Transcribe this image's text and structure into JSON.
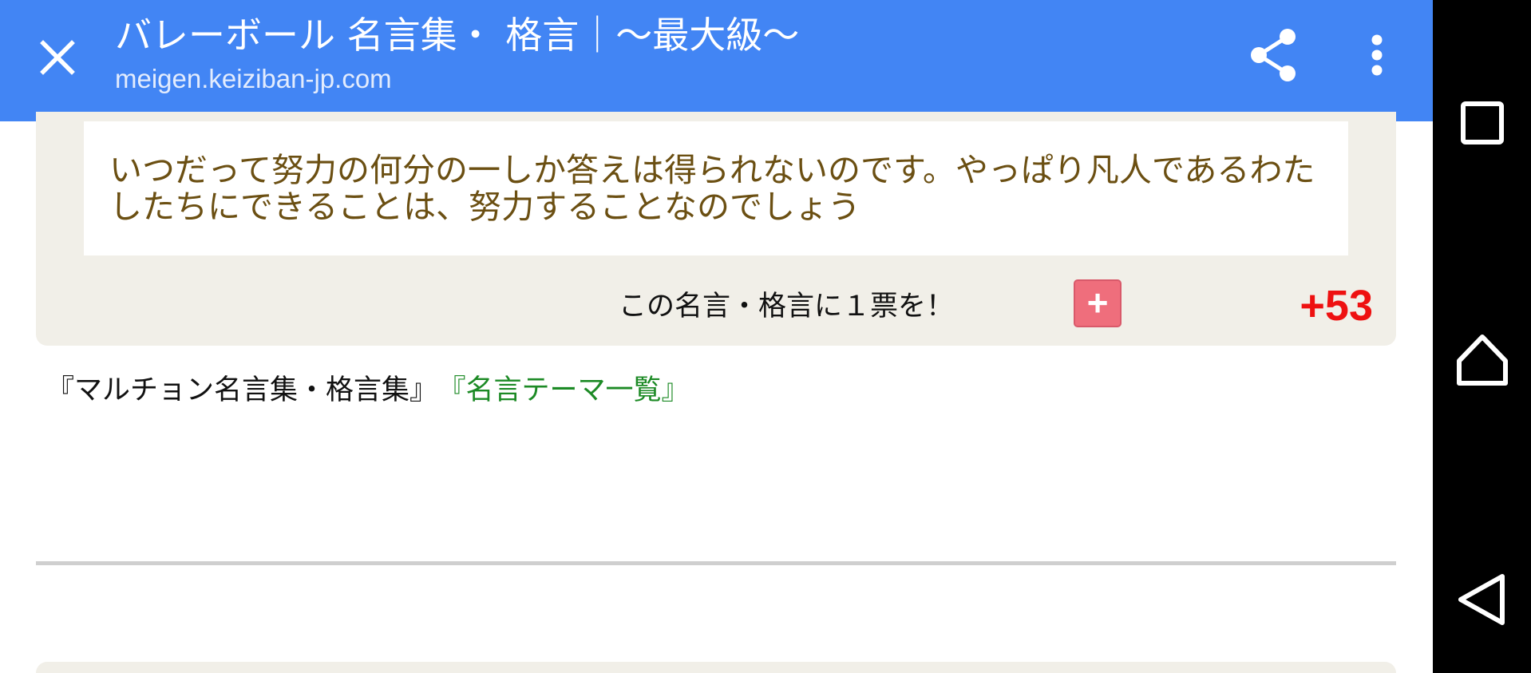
{
  "header": {
    "title": "バレーボール 名言集・ 格言｜～最大級～",
    "url": "meigen.keiziban-jp.com",
    "close_icon": "close-icon",
    "share_icon": "share-icon",
    "more_icon": "more-vert-icon",
    "bar_color": "#4285f4"
  },
  "quote": {
    "text": "いつだって努力の何分の一しか答えは得られないのです。やっぱり凡人であるわたしたちにできることは、努力することなのでしょう",
    "text_color": "#6b4f12"
  },
  "vote": {
    "label": "この名言・格言に１票を！",
    "button_label": "+",
    "count": "+53",
    "count_color": "#ee1111"
  },
  "links": {
    "collection": "『マルチョン名言集・格言集』",
    "themes": "『名言テーマ一覧』"
  },
  "system_nav": {
    "recents_icon": "recents-square-icon",
    "home_icon": "home-icon",
    "back_icon": "back-triangle-icon"
  }
}
